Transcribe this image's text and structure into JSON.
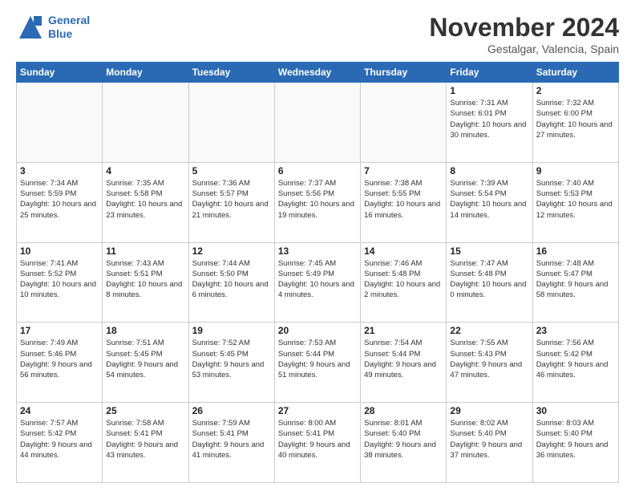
{
  "header": {
    "logo_line1": "General",
    "logo_line2": "Blue",
    "month": "November 2024",
    "location": "Gestalgar, Valencia, Spain"
  },
  "days_of_week": [
    "Sunday",
    "Monday",
    "Tuesday",
    "Wednesday",
    "Thursday",
    "Friday",
    "Saturday"
  ],
  "weeks": [
    [
      {
        "day": "",
        "info": ""
      },
      {
        "day": "",
        "info": ""
      },
      {
        "day": "",
        "info": ""
      },
      {
        "day": "",
        "info": ""
      },
      {
        "day": "",
        "info": ""
      },
      {
        "day": "1",
        "info": "Sunrise: 7:31 AM\nSunset: 6:01 PM\nDaylight: 10 hours and 30 minutes."
      },
      {
        "day": "2",
        "info": "Sunrise: 7:32 AM\nSunset: 6:00 PM\nDaylight: 10 hours and 27 minutes."
      }
    ],
    [
      {
        "day": "3",
        "info": "Sunrise: 7:34 AM\nSunset: 5:59 PM\nDaylight: 10 hours and 25 minutes."
      },
      {
        "day": "4",
        "info": "Sunrise: 7:35 AM\nSunset: 5:58 PM\nDaylight: 10 hours and 23 minutes."
      },
      {
        "day": "5",
        "info": "Sunrise: 7:36 AM\nSunset: 5:57 PM\nDaylight: 10 hours and 21 minutes."
      },
      {
        "day": "6",
        "info": "Sunrise: 7:37 AM\nSunset: 5:56 PM\nDaylight: 10 hours and 19 minutes."
      },
      {
        "day": "7",
        "info": "Sunrise: 7:38 AM\nSunset: 5:55 PM\nDaylight: 10 hours and 16 minutes."
      },
      {
        "day": "8",
        "info": "Sunrise: 7:39 AM\nSunset: 5:54 PM\nDaylight: 10 hours and 14 minutes."
      },
      {
        "day": "9",
        "info": "Sunrise: 7:40 AM\nSunset: 5:53 PM\nDaylight: 10 hours and 12 minutes."
      }
    ],
    [
      {
        "day": "10",
        "info": "Sunrise: 7:41 AM\nSunset: 5:52 PM\nDaylight: 10 hours and 10 minutes."
      },
      {
        "day": "11",
        "info": "Sunrise: 7:43 AM\nSunset: 5:51 PM\nDaylight: 10 hours and 8 minutes."
      },
      {
        "day": "12",
        "info": "Sunrise: 7:44 AM\nSunset: 5:50 PM\nDaylight: 10 hours and 6 minutes."
      },
      {
        "day": "13",
        "info": "Sunrise: 7:45 AM\nSunset: 5:49 PM\nDaylight: 10 hours and 4 minutes."
      },
      {
        "day": "14",
        "info": "Sunrise: 7:46 AM\nSunset: 5:48 PM\nDaylight: 10 hours and 2 minutes."
      },
      {
        "day": "15",
        "info": "Sunrise: 7:47 AM\nSunset: 5:48 PM\nDaylight: 10 hours and 0 minutes."
      },
      {
        "day": "16",
        "info": "Sunrise: 7:48 AM\nSunset: 5:47 PM\nDaylight: 9 hours and 58 minutes."
      }
    ],
    [
      {
        "day": "17",
        "info": "Sunrise: 7:49 AM\nSunset: 5:46 PM\nDaylight: 9 hours and 56 minutes."
      },
      {
        "day": "18",
        "info": "Sunrise: 7:51 AM\nSunset: 5:45 PM\nDaylight: 9 hours and 54 minutes."
      },
      {
        "day": "19",
        "info": "Sunrise: 7:52 AM\nSunset: 5:45 PM\nDaylight: 9 hours and 53 minutes."
      },
      {
        "day": "20",
        "info": "Sunrise: 7:53 AM\nSunset: 5:44 PM\nDaylight: 9 hours and 51 minutes."
      },
      {
        "day": "21",
        "info": "Sunrise: 7:54 AM\nSunset: 5:44 PM\nDaylight: 9 hours and 49 minutes."
      },
      {
        "day": "22",
        "info": "Sunrise: 7:55 AM\nSunset: 5:43 PM\nDaylight: 9 hours and 47 minutes."
      },
      {
        "day": "23",
        "info": "Sunrise: 7:56 AM\nSunset: 5:42 PM\nDaylight: 9 hours and 46 minutes."
      }
    ],
    [
      {
        "day": "24",
        "info": "Sunrise: 7:57 AM\nSunset: 5:42 PM\nDaylight: 9 hours and 44 minutes."
      },
      {
        "day": "25",
        "info": "Sunrise: 7:58 AM\nSunset: 5:41 PM\nDaylight: 9 hours and 43 minutes."
      },
      {
        "day": "26",
        "info": "Sunrise: 7:59 AM\nSunset: 5:41 PM\nDaylight: 9 hours and 41 minutes."
      },
      {
        "day": "27",
        "info": "Sunrise: 8:00 AM\nSunset: 5:41 PM\nDaylight: 9 hours and 40 minutes."
      },
      {
        "day": "28",
        "info": "Sunrise: 8:01 AM\nSunset: 5:40 PM\nDaylight: 9 hours and 38 minutes."
      },
      {
        "day": "29",
        "info": "Sunrise: 8:02 AM\nSunset: 5:40 PM\nDaylight: 9 hours and 37 minutes."
      },
      {
        "day": "30",
        "info": "Sunrise: 8:03 AM\nSunset: 5:40 PM\nDaylight: 9 hours and 36 minutes."
      }
    ]
  ]
}
